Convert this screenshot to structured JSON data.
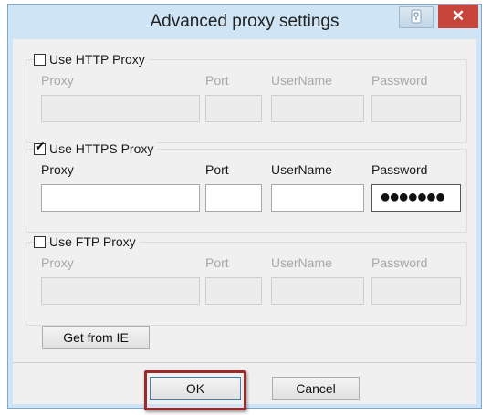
{
  "window": {
    "title": "Advanced proxy settings",
    "close_glyph": "✕",
    "help_icon": "help-icon",
    "close_icon": "close-icon"
  },
  "groups": {
    "http": {
      "label": "Use HTTP Proxy",
      "checked": false,
      "enabled": false,
      "proxy_label": "Proxy",
      "port_label": "Port",
      "username_label": "UserName",
      "password_label": "Password"
    },
    "https": {
      "label": "Use HTTPS Proxy",
      "checked": true,
      "enabled": true,
      "check_glyph": "✔",
      "proxy_label": "Proxy",
      "port_label": "Port",
      "username_label": "UserName",
      "password_label": "Password",
      "password_value": "●●●●●●●"
    },
    "ftp": {
      "label": "Use FTP Proxy",
      "checked": false,
      "enabled": false,
      "proxy_label": "Proxy",
      "port_label": "Port",
      "username_label": "UserName",
      "password_label": "Password"
    }
  },
  "buttons": {
    "get_from_ie": "Get from IE",
    "ok": "OK",
    "cancel": "Cancel"
  },
  "colors": {
    "frame": "#cfe4f4",
    "close": "#c7453b",
    "highlight": "#9c2a2a"
  }
}
